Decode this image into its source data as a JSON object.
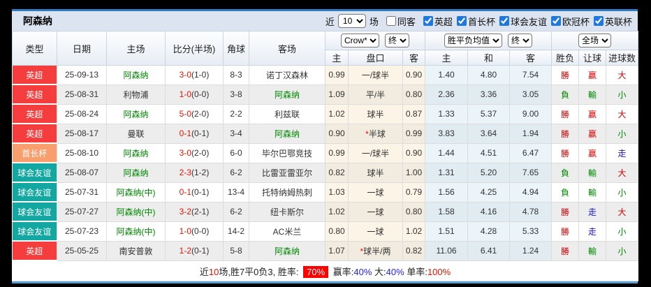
{
  "window": {
    "title": "阿森纳"
  },
  "filter_bar": {
    "recent_label": "近",
    "recent_value": "10",
    "matches_label": "场",
    "same_away_label": "同客",
    "same_away_checked": false,
    "leagues": [
      {
        "label": "英超",
        "checked": true
      },
      {
        "label": "首长杯",
        "checked": true
      },
      {
        "label": "球会友谊",
        "checked": true
      },
      {
        "label": "欧冠杯",
        "checked": true
      },
      {
        "label": "英联杯",
        "checked": true
      }
    ]
  },
  "selectors": {
    "bookmaker": "Crow*",
    "bookmaker_state": "终",
    "odds_view": "胜平负均值",
    "odds_state": "终",
    "scope": "全场"
  },
  "columns": {
    "type": "类型",
    "date": "日期",
    "home": "主场",
    "score": "比分(半场)",
    "corner": "角球",
    "away": "客场",
    "hcp_home": "主",
    "handicap": "盘口",
    "hcp_away": "客",
    "win": "主",
    "draw": "和",
    "lose": "客",
    "result": "胜负",
    "spread": "让球",
    "goals": "进球数"
  },
  "colors": {
    "accent_border": "#2c7cc3",
    "league_epl": "#f53d3d",
    "league_community": "#f99e6d",
    "league_friendly": "#13a7a1",
    "win_red": "#d50000",
    "lose_green": "#008800",
    "push_blue": "#1515d0",
    "summary_pill": "#ff0000"
  },
  "rows": [
    {
      "type": "英超",
      "type_color": "#f53d3d",
      "date": "25-09-13",
      "home": "阿森纳",
      "home_green": true,
      "score": "3-0",
      "half": "(1-0)",
      "corners": "8-3",
      "away": "诺丁汉森林",
      "away_green": false,
      "hcp_home": "0.99",
      "handicap": "一/球半",
      "handicap_star": false,
      "hcp_away": "0.90",
      "odds_win": "1.40",
      "odds_draw": "4.80",
      "odds_lose": "7.54",
      "result": "勝",
      "result_c": "red",
      "spread": "赢",
      "spread_c": "red",
      "goals": "大",
      "goals_c": "red"
    },
    {
      "type": "英超",
      "type_color": "#f53d3d",
      "date": "25-08-31",
      "home": "利物浦",
      "home_green": false,
      "score": "1-0",
      "half": "(0-0)",
      "corners": "3-8",
      "away": "阿森纳",
      "away_green": true,
      "hcp_home": "1.09",
      "handicap": "平/半",
      "handicap_star": false,
      "hcp_away": "0.80",
      "odds_win": "2.36",
      "odds_draw": "3.36",
      "odds_lose": "3.05",
      "result": "負",
      "result_c": "green",
      "spread": "輸",
      "spread_c": "green",
      "goals": "小",
      "goals_c": "green"
    },
    {
      "type": "英超",
      "type_color": "#f53d3d",
      "date": "25-08-24",
      "home": "阿森纳",
      "home_green": true,
      "score": "5-0",
      "half": "(2-0)",
      "corners": "2-2",
      "away": "利兹联",
      "away_green": false,
      "hcp_home": "1.02",
      "handicap": "球半",
      "handicap_star": false,
      "hcp_away": "0.87",
      "odds_win": "1.33",
      "odds_draw": "5.37",
      "odds_lose": "9.00",
      "result": "勝",
      "result_c": "red",
      "spread": "赢",
      "spread_c": "red",
      "goals": "大",
      "goals_c": "red"
    },
    {
      "type": "英超",
      "type_color": "#f53d3d",
      "date": "25-08-17",
      "home": "曼联",
      "home_green": false,
      "score": "0-1",
      "half": "(0-1)",
      "corners": "3-4",
      "away": "阿森纳",
      "away_green": true,
      "hcp_home": "0.90",
      "handicap": "半球",
      "handicap_star": true,
      "hcp_away": "0.99",
      "odds_win": "3.83",
      "odds_draw": "3.64",
      "odds_lose": "1.94",
      "result": "勝",
      "result_c": "red",
      "spread": "赢",
      "spread_c": "red",
      "goals": "小",
      "goals_c": "green"
    },
    {
      "type": "首长杯",
      "type_color": "#f99e6d",
      "date": "25-08-10",
      "home": "阿森纳",
      "home_green": true,
      "score": "3-0",
      "half": "(2-0)",
      "corners": "6-0",
      "away": "毕尔巴鄂竞技",
      "away_green": false,
      "hcp_home": "0.99",
      "handicap": "一/球半",
      "handicap_star": false,
      "hcp_away": "0.90",
      "odds_win": "1.44",
      "odds_draw": "4.51",
      "odds_lose": "6.47",
      "result": "勝",
      "result_c": "red",
      "spread": "赢",
      "spread_c": "red",
      "goals": "走",
      "goals_c": "blue"
    },
    {
      "type": "球会友谊",
      "type_color": "#13a7a1",
      "date": "25-08-07",
      "home": "阿森纳",
      "home_green": true,
      "score": "2-3",
      "half": "(1-2)",
      "corners": "6-2",
      "away": "比雷亚雷亚尔",
      "away_green": false,
      "hcp_home": "0.82",
      "handicap": "球半",
      "handicap_star": false,
      "hcp_away": "1.00",
      "odds_win": "1.31",
      "odds_draw": "5.20",
      "odds_lose": "7.65",
      "result": "負",
      "result_c": "green",
      "spread": "輸",
      "spread_c": "green",
      "goals": "大",
      "goals_c": "red"
    },
    {
      "type": "球会友谊",
      "type_color": "#13a7a1",
      "date": "25-07-31",
      "home": "阿森纳(中)",
      "home_green": true,
      "score": "0-1",
      "half": "(0-1)",
      "corners": "13-4",
      "away": "托特纳姆热刺",
      "away_green": false,
      "hcp_home": "1.03",
      "handicap": "一球",
      "handicap_star": false,
      "hcp_away": "0.79",
      "odds_win": "1.56",
      "odds_draw": "4.25",
      "odds_lose": "4.94",
      "result": "負",
      "result_c": "green",
      "spread": "輸",
      "spread_c": "green",
      "goals": "小",
      "goals_c": "green"
    },
    {
      "type": "球会友谊",
      "type_color": "#13a7a1",
      "date": "25-07-27",
      "home": "阿森纳(中)",
      "home_green": true,
      "score": "3-2",
      "half": "(2-1)",
      "corners": "6-2",
      "away": "纽卡斯尔",
      "away_green": false,
      "hcp_home": "1.02",
      "handicap": "一球",
      "handicap_star": false,
      "hcp_away": "0.80",
      "odds_win": "1.58",
      "odds_draw": "4.16",
      "odds_lose": "4.78",
      "result": "勝",
      "result_c": "red",
      "spread": "走",
      "spread_c": "blue",
      "goals": "大",
      "goals_c": "red"
    },
    {
      "type": "球会友谊",
      "type_color": "#13a7a1",
      "date": "25-07-23",
      "home": "阿森纳(中)",
      "home_green": true,
      "score": "1-0",
      "half": "(0-0)",
      "corners": "14-2",
      "away": "AC米兰",
      "away_green": false,
      "hcp_home": "0.80",
      "handicap": "一球",
      "handicap_star": false,
      "hcp_away": "1.02",
      "odds_win": "1.51",
      "odds_draw": "4.28",
      "odds_lose": "5.33",
      "result": "勝",
      "result_c": "red",
      "spread": "走",
      "spread_c": "blue",
      "goals": "小",
      "goals_c": "green"
    },
    {
      "type": "英超",
      "type_color": "#f53d3d",
      "date": "25-05-25",
      "home": "南安普敦",
      "home_green": false,
      "score": "1-2",
      "half": "(0-1)",
      "corners": "5-8",
      "away": "阿森纳",
      "away_green": true,
      "hcp_home": "1.07",
      "handicap": "球半/两",
      "handicap_star": true,
      "hcp_away": "0.82",
      "odds_win": "11.06",
      "odds_draw": "6.41",
      "odds_lose": "1.24",
      "result": "勝",
      "result_c": "red",
      "spread": "輸",
      "spread_c": "green",
      "goals": "小",
      "goals_c": "green"
    }
  ],
  "summary": {
    "prefix": "近",
    "count": "10",
    "record": "场,胜7平0负3, 胜率:",
    "win_rate": "70%",
    "spread_label": "赢率:",
    "spread_rate": "40%",
    "goals_label": "大:",
    "goals_rate": "40%",
    "single_label": "单率:",
    "single_rate": "100%"
  }
}
